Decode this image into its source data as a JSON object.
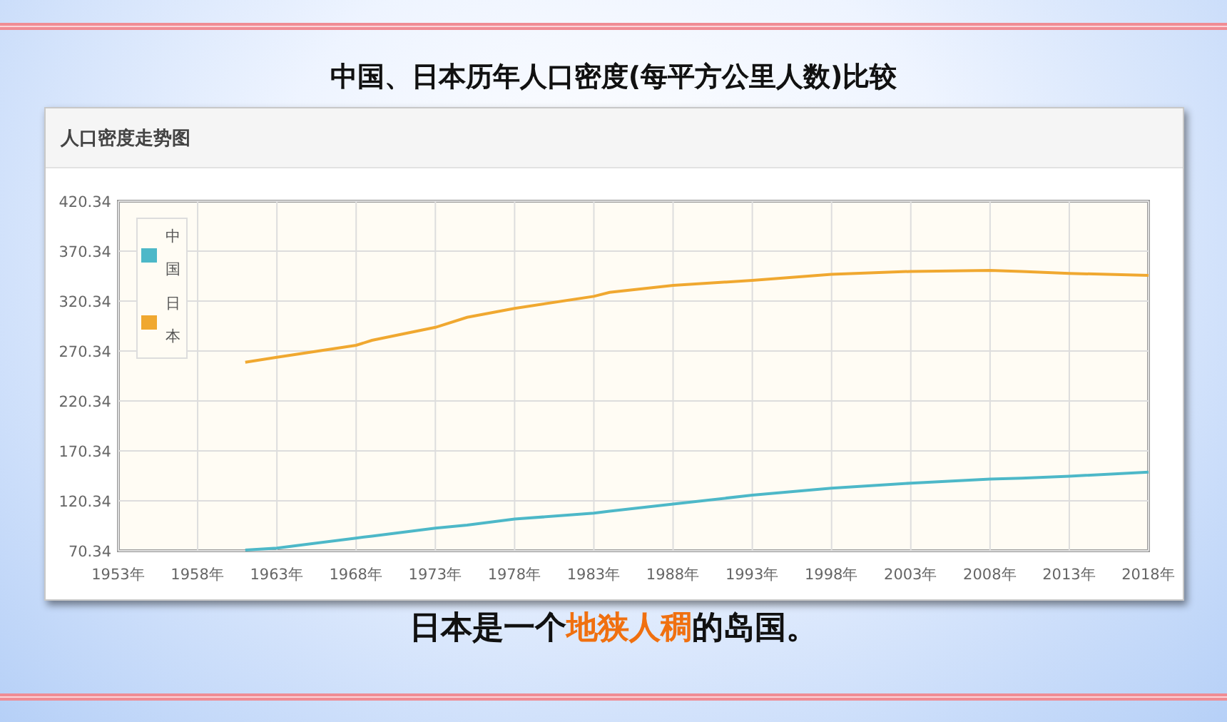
{
  "title": "中国、日本历年人口密度(每平方公里人数)比较",
  "panel": {
    "title": "人口密度走势图",
    "chart_data": {
      "type": "line",
      "x": [
        1961,
        1963,
        1968,
        1969,
        1973,
        1975,
        1978,
        1983,
        1984,
        1988,
        1993,
        1998,
        2003,
        2008,
        2010,
        2013,
        2018
      ],
      "series": [
        {
          "name": "中国",
          "color": "#4db8c8",
          "values": [
            71,
            73,
            83,
            85,
            93,
            96,
            102,
            108,
            110,
            117,
            126,
            133,
            138,
            142,
            143,
            145,
            149
          ]
        },
        {
          "name": "日本",
          "color": "#f0a830",
          "values": [
            259,
            264,
            276,
            281,
            294,
            304,
            313,
            325,
            329,
            336,
            341,
            347,
            350,
            351,
            350,
            348,
            346
          ]
        }
      ],
      "grid": true,
      "legend": true,
      "xlim": [
        1953,
        2018
      ],
      "ylim": [
        70.34,
        420.34
      ],
      "xticks": [
        {
          "value": 1953,
          "label": "1953年"
        },
        {
          "value": 1958,
          "label": "1958年"
        },
        {
          "value": 1963,
          "label": "1963年"
        },
        {
          "value": 1968,
          "label": "1968年"
        },
        {
          "value": 1973,
          "label": "1973年"
        },
        {
          "value": 1978,
          "label": "1978年"
        },
        {
          "value": 1983,
          "label": "1983年"
        },
        {
          "value": 1988,
          "label": "1988年"
        },
        {
          "value": 1993,
          "label": "1993年"
        },
        {
          "value": 1998,
          "label": "1998年"
        },
        {
          "value": 2003,
          "label": "2003年"
        },
        {
          "value": 2008,
          "label": "2008年"
        },
        {
          "value": 2013,
          "label": "2013年"
        },
        {
          "value": 2018,
          "label": "2018年"
        }
      ],
      "yticks": [
        {
          "value": 70.34,
          "label": "70.34"
        },
        {
          "value": 120.34,
          "label": "120.34"
        },
        {
          "value": 170.34,
          "label": "170.34"
        },
        {
          "value": 220.34,
          "label": "220.34"
        },
        {
          "value": 270.34,
          "label": "270.34"
        },
        {
          "value": 320.34,
          "label": "320.34"
        },
        {
          "value": 370.34,
          "label": "370.34"
        },
        {
          "value": 420.34,
          "label": "420.34"
        }
      ]
    }
  },
  "caption": [
    {
      "text": "日本是一个",
      "highlight": false
    },
    {
      "text": "地狭人稠",
      "highlight": true
    },
    {
      "text": "的岛国。",
      "highlight": false
    }
  ]
}
